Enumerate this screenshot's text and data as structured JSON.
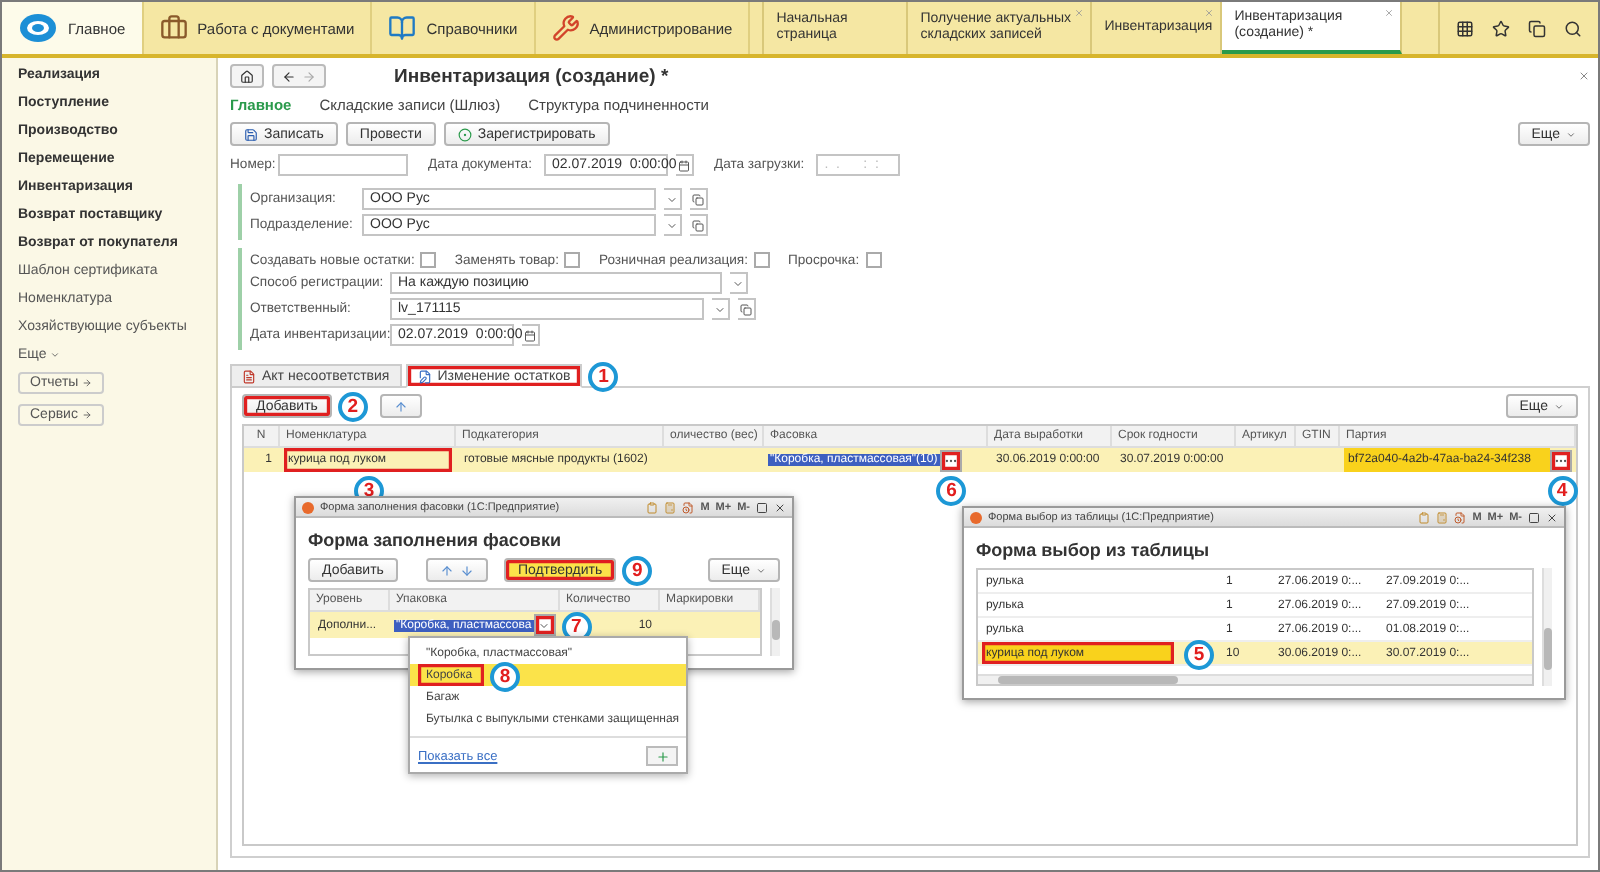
{
  "top_sections": [
    {
      "label": "Главное",
      "selected": true
    },
    {
      "label": "Работа с документами",
      "selected": false
    },
    {
      "label": "Справочники",
      "selected": false
    },
    {
      "label": "Администрирование",
      "selected": false
    }
  ],
  "open_tabs": [
    {
      "label": "Начальная страница",
      "selected": false,
      "closable": false
    },
    {
      "label": "Получение актуальных складских записей",
      "selected": false,
      "closable": true
    },
    {
      "label": "Инвентаризация",
      "selected": false,
      "closable": true
    },
    {
      "label": "Инвентаризация (создание) *",
      "selected": true,
      "closable": true
    }
  ],
  "sidebar": {
    "items": [
      {
        "label": "Реализация",
        "bold": true
      },
      {
        "label": "Поступление",
        "bold": true
      },
      {
        "label": "Производство",
        "bold": true
      },
      {
        "label": "Перемещение",
        "bold": true
      },
      {
        "label": "Инвентаризация",
        "bold": true
      },
      {
        "label": "Возврат поставщику",
        "bold": true
      },
      {
        "label": "Возврат от покупателя",
        "bold": true
      },
      {
        "label": "Шаблон сертификата",
        "bold": false
      },
      {
        "label": "Номенклатура",
        "bold": false
      },
      {
        "label": "Хозяйствующие субъекты",
        "bold": false
      }
    ],
    "more": "Еще",
    "buttons": [
      "Отчеты",
      "Сервис"
    ]
  },
  "form": {
    "title": "Инвентаризация (создание) *",
    "sections": [
      {
        "label": "Главное",
        "selected": true
      },
      {
        "label": "Складские записи (Шлюз)",
        "selected": false
      },
      {
        "label": "Структура подчиненности",
        "selected": false
      }
    ],
    "toolbar": [
      "Записать",
      "Провести",
      "Зарегистрировать"
    ],
    "more": "Еще",
    "number": {
      "label": "Номер:"
    },
    "doc_date": {
      "label": "Дата документа:",
      "value": "02.07.2019  0:00:00"
    },
    "load_date": {
      "label": "Дата загрузки:",
      "placeholder": ".  .      :  :"
    },
    "organization": {
      "label": "Организация:",
      "value": "ООО Рус"
    },
    "division": {
      "label": "Подразделение:",
      "value": "ООО Рус"
    },
    "checkboxes": [
      {
        "label": "Создавать новые остатки:",
        "checked": false
      },
      {
        "label": "Заменять товар:",
        "checked": false
      },
      {
        "label": "Розничная реализация:",
        "checked": false
      },
      {
        "label": "Просрочка:",
        "checked": false
      }
    ],
    "reg_method": {
      "label": "Способ регистрации:",
      "value": "На каждую позицию"
    },
    "responsible": {
      "label": "Ответственный:",
      "value": "lv_171115"
    },
    "inventory_date": {
      "label": "Дата инвентаризации:",
      "value": "02.07.2019  0:00:00"
    }
  },
  "detail_tabs": [
    {
      "label": "Акт несоответствия",
      "selected": false
    },
    {
      "label": "Изменение остатков",
      "selected": true,
      "callout": "1"
    }
  ],
  "table": {
    "add_button": {
      "label": "Добавить",
      "callout": "2"
    },
    "more": "Еще",
    "columns": [
      {
        "label": "N",
        "kind": "num"
      },
      {
        "label": "Номенклатура",
        "kind": "text"
      },
      {
        "label": "Подкатегория",
        "kind": "text"
      },
      {
        "label": "оличество (вес)",
        "kind": "text"
      },
      {
        "label": "Фасовка",
        "kind": "picker"
      },
      {
        "label": "Дата выработки",
        "kind": "text"
      },
      {
        "label": "Срок годности",
        "kind": "text"
      },
      {
        "label": "Артикул",
        "kind": "text"
      },
      {
        "label": "GTIN",
        "kind": "text"
      },
      {
        "label": "Партия",
        "kind": "batch"
      }
    ],
    "rows": [
      {
        "selected": true,
        "cells": [
          {
            "text": "1"
          },
          {
            "text": "курица под луком",
            "callout": "3"
          },
          {
            "text": "готовые мясные продукты (1602)"
          },
          {},
          {
            "text": "\"Коробка, пластмассовая\"(10)",
            "callout": "6"
          },
          {
            "text": "30.06.2019 0:00:00"
          },
          {
            "text": "30.07.2019 0:00:00"
          },
          {},
          {},
          {
            "text": "bf72a040-4a2b-47aa-ba24-34f238",
            "callout": "4"
          }
        ]
      }
    ]
  },
  "packing_window": {
    "window_title": "Форма заполнения фасовки (1С:Предприятие)",
    "title_buttons": [
      "M",
      "M+",
      "M-"
    ],
    "heading": "Форма заполнения фасовки",
    "add_button": "Добавить",
    "confirm_button": {
      "label": "Подтвердить",
      "callout": "9"
    },
    "more": "Еще",
    "columns": [
      "Уровень",
      "Упаковка",
      "Количество",
      "Маркировки"
    ],
    "row": {
      "level": "Дополни...",
      "packing": "\"Коробка, пластмассова",
      "quantity": "10",
      "callout": "7"
    },
    "dropdown": {
      "items": [
        {
          "label": "\"Коробка, пластмассовая\"",
          "selected": false
        },
        {
          "label": "Коробка",
          "selected": true,
          "callout": "8"
        },
        {
          "label": "Багаж",
          "selected": false
        },
        {
          "label": "Бутылка с выпуклыми стенками защищенная",
          "selected": false
        }
      ],
      "show_all": "Показать все"
    }
  },
  "select_window": {
    "window_title": "Форма выбор из таблицы (1С:Предприятие)",
    "title_buttons": [
      "M",
      "M+",
      "M-"
    ],
    "heading": "Форма выбор из таблицы",
    "rows": [
      {
        "selected": false,
        "cells": [
          "рулька",
          "1",
          "27.06.2019 0:...",
          "27.09.2019 0:..."
        ]
      },
      {
        "selected": false,
        "cells": [
          "рулька",
          "1",
          "27.06.2019 0:...",
          "27.09.2019 0:..."
        ]
      },
      {
        "selected": false,
        "cells": [
          "рулька",
          "1",
          "27.06.2019 0:...",
          "01.08.2019 0:..."
        ]
      },
      {
        "selected": true,
        "callout": "5",
        "cells": [
          "курица под луком",
          "10",
          "30.06.2019 0:...",
          "30.07.2019 0:..."
        ]
      }
    ]
  }
}
